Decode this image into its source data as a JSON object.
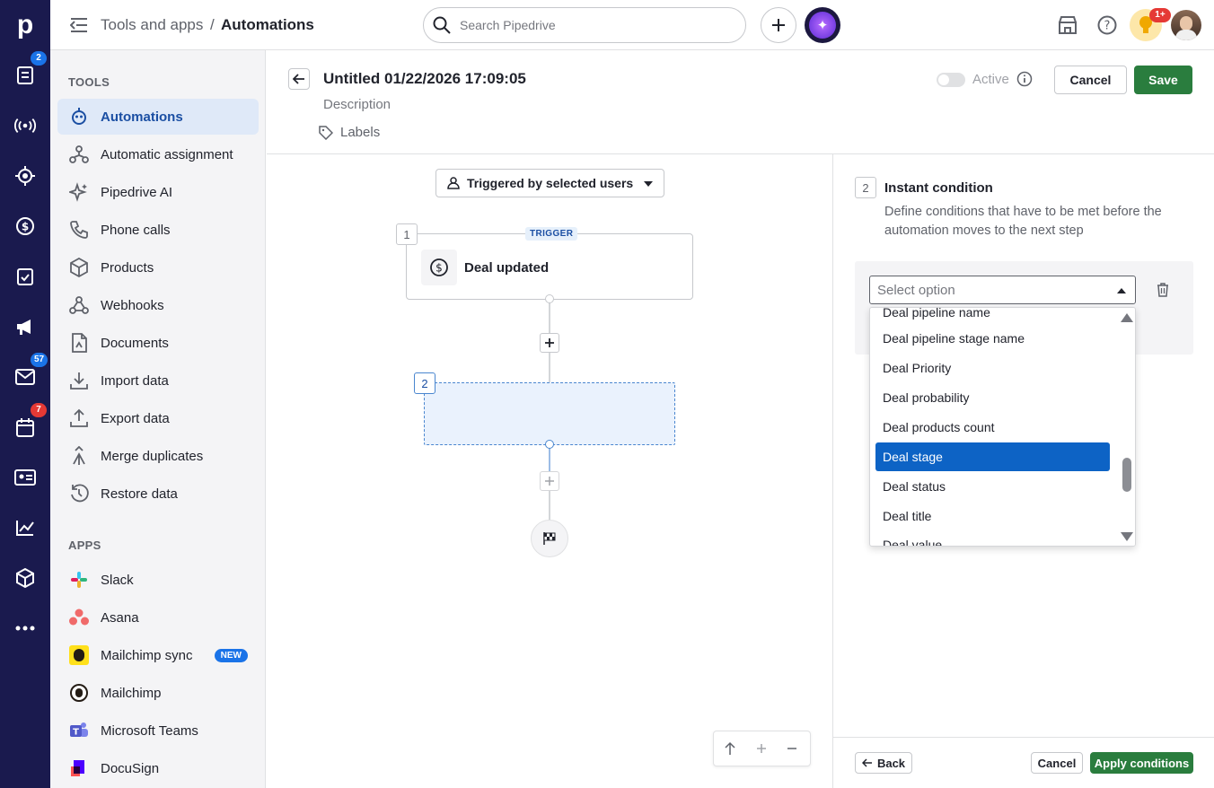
{
  "rail": {
    "badges": {
      "leads": "2",
      "mail": "57",
      "calendar": "7"
    }
  },
  "topbar": {
    "crumb_parent": "Tools and apps",
    "crumb_sep": "/",
    "crumb_current": "Automations",
    "search_placeholder": "Search Pipedrive",
    "notif_badge": "1+"
  },
  "sidebar": {
    "tools_title": "TOOLS",
    "tools": [
      {
        "label": "Automations"
      },
      {
        "label": "Automatic assignment"
      },
      {
        "label": "Pipedrive AI"
      },
      {
        "label": "Phone calls"
      },
      {
        "label": "Products"
      },
      {
        "label": "Webhooks"
      },
      {
        "label": "Documents"
      },
      {
        "label": "Import data"
      },
      {
        "label": "Export data"
      },
      {
        "label": "Merge duplicates"
      },
      {
        "label": "Restore data"
      }
    ],
    "apps_title": "APPS",
    "apps": [
      {
        "label": "Slack"
      },
      {
        "label": "Asana"
      },
      {
        "label": "Mailchimp sync",
        "badge": "NEW"
      },
      {
        "label": "Mailchimp"
      },
      {
        "label": "Microsoft Teams"
      },
      {
        "label": "DocuSign"
      }
    ]
  },
  "editor": {
    "title": "Untitled 01/22/2026 17:09:05",
    "description": "Description",
    "labels": "Labels",
    "active_label": "Active",
    "cancel": "Cancel",
    "save": "Save"
  },
  "canvas": {
    "trigger_scope": "Triggered by selected users",
    "step1_num": "1",
    "trigger_tag": "TRIGGER",
    "trigger_label": "Deal updated",
    "step2_num": "2"
  },
  "condition": {
    "step_num": "2",
    "title": "Instant condition",
    "description": "Define conditions that have to be met before the automation moves to the next step",
    "select_placeholder": "Select option",
    "options": [
      "Deal pipeline name",
      "Deal pipeline stage name",
      "Deal Priority",
      "Deal probability",
      "Deal products count",
      "Deal stage",
      "Deal status",
      "Deal title",
      "Deal value"
    ],
    "selected_option": "Deal stage",
    "back": "Back",
    "cancel": "Cancel",
    "apply": "Apply conditions"
  },
  "colors": {
    "rail": "#1a1a4e",
    "primary": "#2a7d3e",
    "selected": "#0d63c5"
  }
}
